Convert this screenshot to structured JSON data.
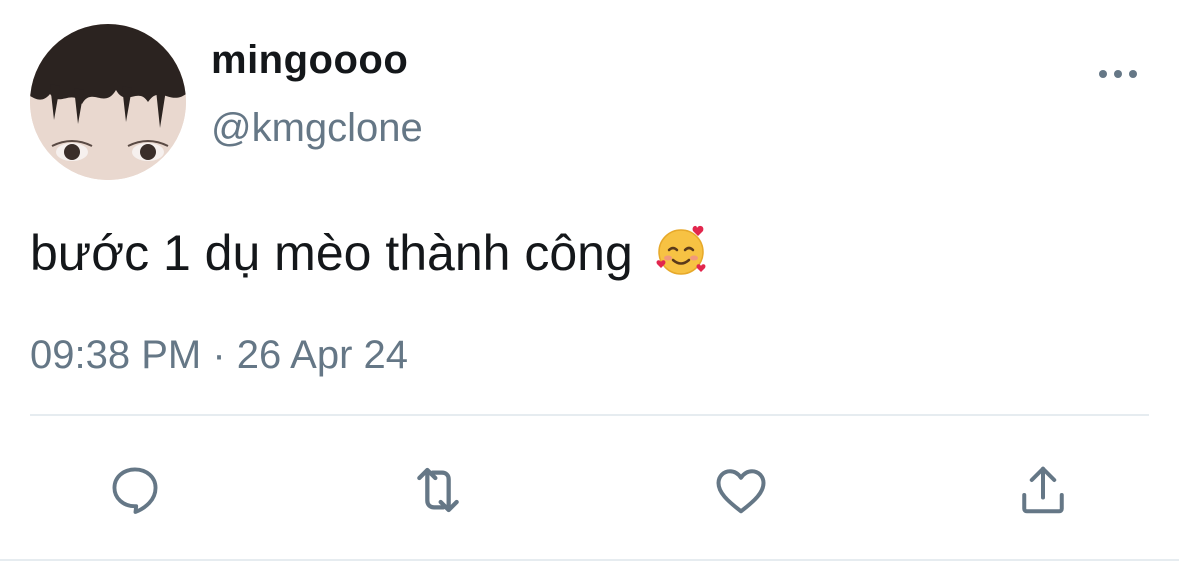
{
  "author": {
    "display_name": "mingoooo",
    "handle": "@kmgclone"
  },
  "tweet": {
    "text": "bước 1 dụ mèo thành công",
    "emoji": "smiling-face-with-hearts-emoji",
    "timestamp": "09:38 PM · 26 Apr 24"
  },
  "actions": [
    {
      "name": "reply",
      "icon": "reply-icon"
    },
    {
      "name": "retweet",
      "icon": "retweet-icon"
    },
    {
      "name": "like",
      "icon": "heart-icon"
    },
    {
      "name": "share",
      "icon": "share-icon"
    }
  ],
  "colors": {
    "text_primary": "#14171a",
    "text_secondary": "#657786",
    "divider": "#e6ecf0"
  }
}
